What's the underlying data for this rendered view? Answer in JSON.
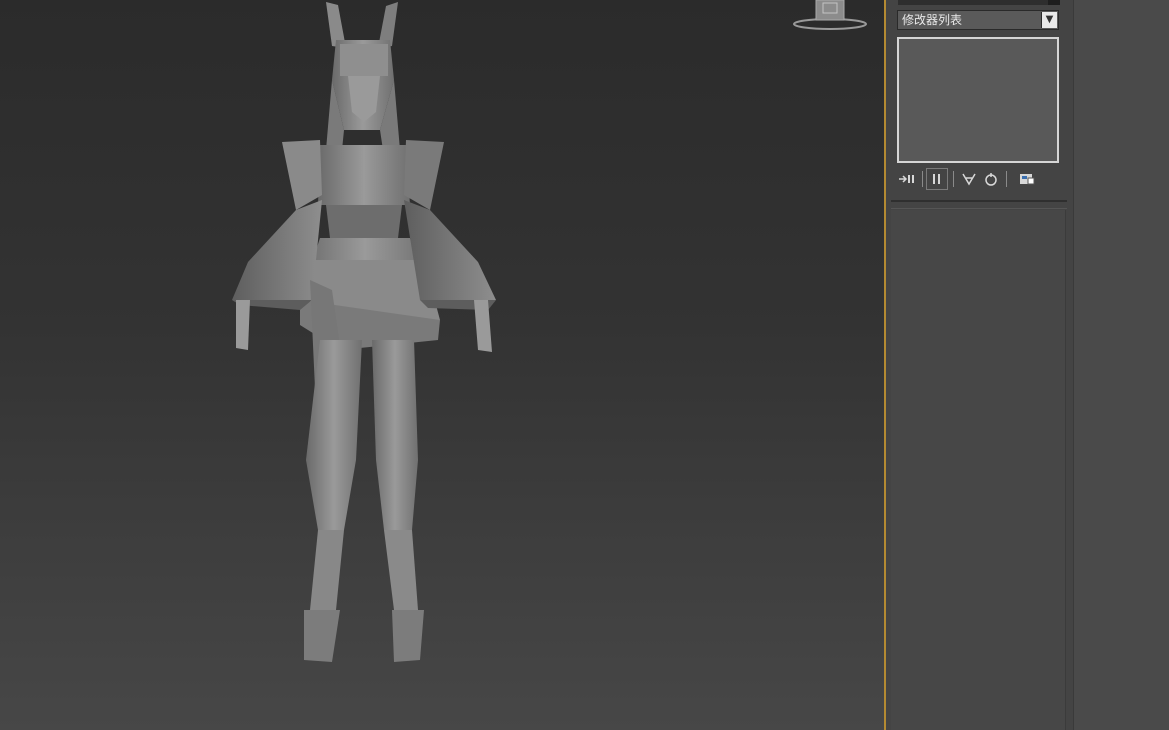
{
  "modifier_panel": {
    "modifier_list_label": "修改器列表",
    "dropdown_icon": "chevron-down-icon",
    "stack_tools": [
      "pin-stack-icon",
      "show-end-result-icon",
      "make-unique-icon",
      "remove-modifier-icon",
      "configure-modifier-sets-icon"
    ]
  },
  "colors": {
    "viewport_top": "#2b2b2b",
    "viewport_bottom": "#474747",
    "viewport_border_active": "#b48a32",
    "panel_bg": "#444444",
    "model_gray": "#8a8a8a"
  }
}
